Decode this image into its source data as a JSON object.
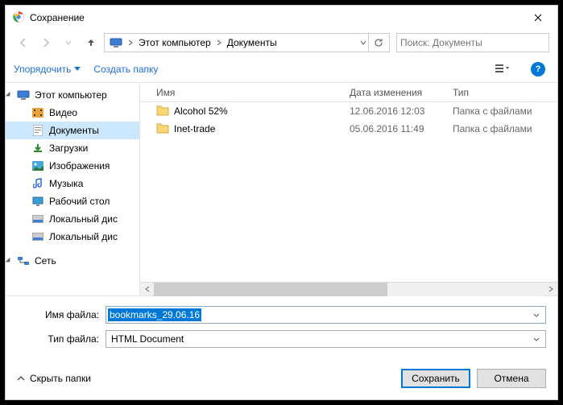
{
  "title": "Сохранение",
  "breadcrumb": {
    "root": "Этот компьютер",
    "current": "Документы"
  },
  "search": {
    "placeholder": "Поиск: Документы"
  },
  "toolbar": {
    "organize": "Упорядочить",
    "newFolder": "Создать папку"
  },
  "tree": {
    "root": "Этот компьютер",
    "items": [
      {
        "label": "Видео",
        "icon": "video"
      },
      {
        "label": "Документы",
        "icon": "doc",
        "selected": true
      },
      {
        "label": "Загрузки",
        "icon": "download"
      },
      {
        "label": "Изображения",
        "icon": "image"
      },
      {
        "label": "Музыка",
        "icon": "music"
      },
      {
        "label": "Рабочий стол",
        "icon": "desktop"
      },
      {
        "label": "Локальный дис",
        "icon": "disk"
      },
      {
        "label": "Локальный дис",
        "icon": "disk"
      }
    ],
    "network": "Сеть"
  },
  "list": {
    "headers": {
      "name": "Имя",
      "date": "Дата изменения",
      "type": "Тип"
    },
    "rows": [
      {
        "name": "Alcohol 52%",
        "date": "12.06.2016 12:03",
        "type": "Папка с файлами"
      },
      {
        "name": "Inet-trade",
        "date": "05.06.2016 11:49",
        "type": "Папка с файлами"
      }
    ]
  },
  "fields": {
    "filenameLabel": "Имя файла:",
    "filename": "bookmarks_29.06.16",
    "filetypeLabel": "Тип файла:",
    "filetype": "HTML Document"
  },
  "footer": {
    "hideFolders": "Скрыть папки",
    "save": "Сохранить",
    "cancel": "Отмена"
  }
}
